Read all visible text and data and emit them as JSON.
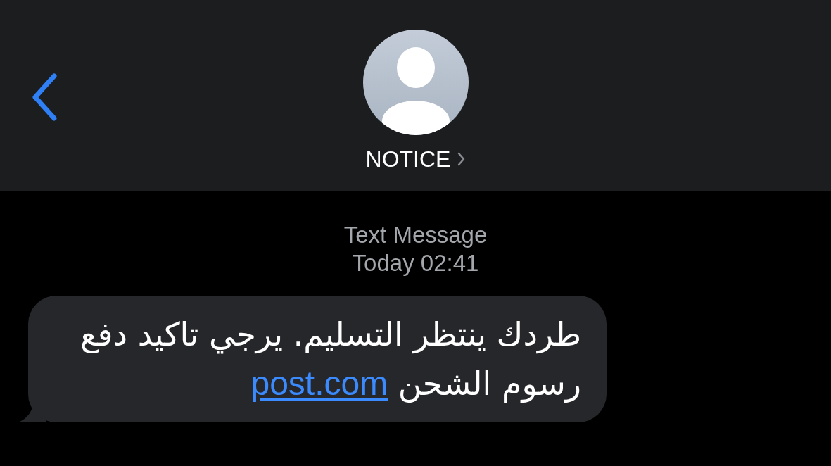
{
  "header": {
    "contact": {
      "name": "NOTICE"
    }
  },
  "conversation": {
    "label": "Text Message",
    "timestamp": "Today 02:41",
    "messages": [
      {
        "kind": "incoming",
        "text": "طردك ينتظر التسليم. يرجي تاكيد دفع رسوم الشحن",
        "link": "post.com"
      }
    ]
  }
}
